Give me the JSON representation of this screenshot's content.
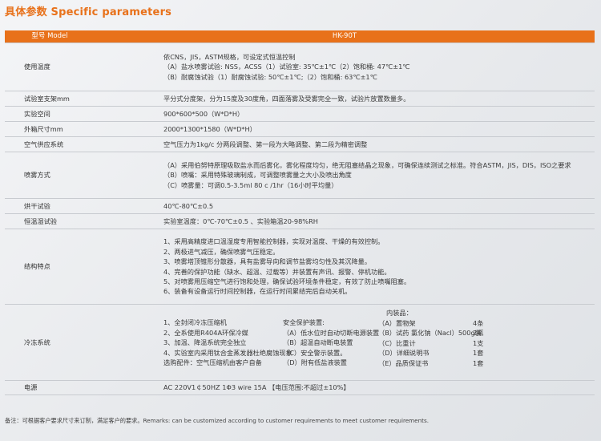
{
  "title": "具体参数 Specific parameters",
  "header": {
    "model_label": "型号 Model",
    "model_value": "HK-90T"
  },
  "rows": {
    "temp": {
      "label": "使用温度",
      "lines": [
        "依CNS，JIS，ASTM规格，可设定式恒温控制",
        "（A）盐水喷雾试验: NSS，ACSS（1）试验室: 35℃±1℃（2）饱和桶: 47℃±1℃",
        "（B）耐腐蚀试验（1）耐腐蚀试验: 50℃±1℃;（2）饱和桶: 63℃±1℃"
      ]
    },
    "rack": {
      "label": "试验室支架mm",
      "value": "平分式分度架，分为15度及30度角，四面落雾及受雾完全一致，试验片放置数量多。"
    },
    "space": {
      "label": "实验空间",
      "value": "900*600*500（W*D*H）"
    },
    "outer": {
      "label": "外箱尺寸mm",
      "value": "2000*1300*1580（W*D*H）"
    },
    "air": {
      "label": "空气供应系统",
      "value": "空气压力为1kg/c   分两段调整、第一段为大略调整、第二段为精密调整"
    },
    "spray": {
      "label": "喷雾方式",
      "lines": [
        "（A）采用伯努特原理吸取盐水而后雾化，雾化程度均匀，绝无阻塞结晶之现象，可确保连续测试之标准。符合ASTM，JIS，DIS，ISO之要求",
        "（B）喷嘴：采用特殊玻璃制成，可调整喷雾量之大小及喷出角度",
        "（C）喷雾量：可调0.5-3.5ml  80 c  /1hr（16小时平均量）"
      ]
    },
    "dry": {
      "label": "烘干试验",
      "value": "40℃-80℃±0.5"
    },
    "constant": {
      "label": "恒温湿试验",
      "value": "实验室温度：0℃-70℃±0.5 、实验箱温20-98%RH"
    },
    "structure": {
      "label": "结构特点",
      "lines": [
        "1、采用高精度进口温湿度专用智能控制器，实现对温度、干燥的有效控制。",
        "2、两极进气减压，确保喷雾气压稳定。",
        "3、喷雾塔顶锥形分散器，具有盐雾导向和调节盐雾均匀性及其沉降量。",
        "4、完善的保护功能（缺水、超温、过载等）并装置有声讯、报警、停机功能。",
        "5、对喷雾用压缩空气进行饱和处理，确保试验环境条件稳定，有效了防止喷嘴阻塞。",
        "6、装备有设备运行时间控制器，在运行时间累结完后自动关机。"
      ]
    },
    "cooling": {
      "label": "冷冻系统",
      "col1": [
        "1、全封闭冷冻压缩机",
        "2、全系使用R404A环保冷媒",
        "3、加温、降温系统完全独立",
        "4、实验室内采用钛合金蒸发器杜绝腐蚀现象",
        "选购配件：空气压缩机由客户自备"
      ],
      "col2_title": "安全保护装置:",
      "col2": [
        "（A）低水位时自动切断电源装置",
        "（B）超温自动断电装置",
        "（C）安全警示装置。",
        "（D）附有低盐液装置"
      ],
      "col3_title": "内装品：",
      "col3": [
        "（A）置物架",
        "（B）试药  氯化钠（Nacl）500g装",
        "（C）比重计",
        "（D）详细说明书",
        "（E）品质保证书"
      ],
      "col4": [
        "4条",
        "2瓶",
        "1支",
        "1套",
        "1套"
      ]
    },
    "power": {
      "label": "电源",
      "value": "AC 220V1￠50HZ  1Φ3 wire 15A 【电压范围:不超过±10%】"
    }
  },
  "note": "备注：可根据客户要求尺寸来订制，满足客户的要求。Remarks: can be customized according to customer requirements to meet customer requirements."
}
